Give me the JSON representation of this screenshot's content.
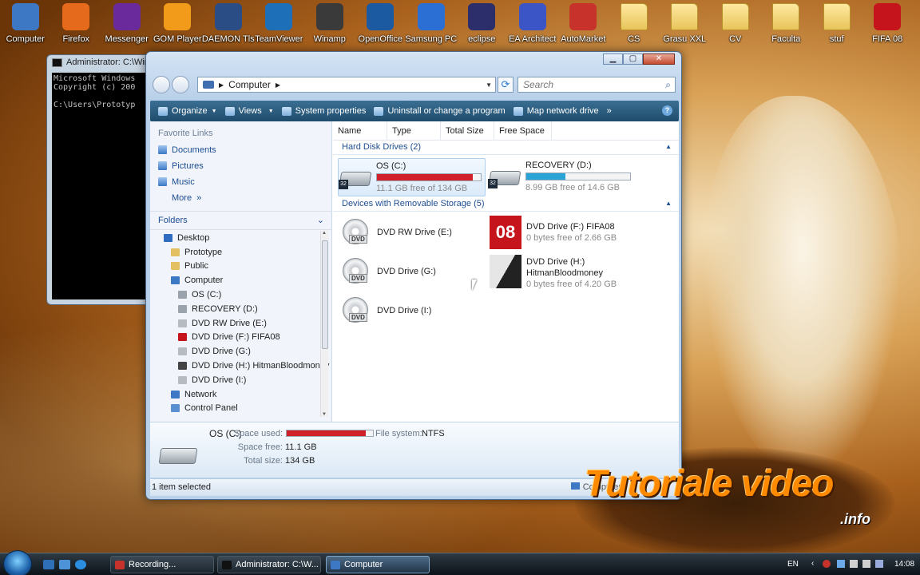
{
  "desktop": {
    "icons": [
      {
        "label": "Computer",
        "color": "#3d78c5"
      },
      {
        "label": "Firefox",
        "color": "#e56a1c"
      },
      {
        "label": "Messenger",
        "color": "#6b2a9c"
      },
      {
        "label": "GOM Player",
        "color": "#f29a1a"
      },
      {
        "label": "DAEMON Tls",
        "color": "#2b4d86"
      },
      {
        "label": "TeamViewer",
        "color": "#1d6fb8"
      },
      {
        "label": "Winamp",
        "color": "#3a3a3a"
      },
      {
        "label": "OpenOffice",
        "color": "#1b5aa0"
      },
      {
        "label": "Samsung PC",
        "color": "#2b6fd4"
      },
      {
        "label": "eclipse",
        "color": "#2c2d6b"
      },
      {
        "label": "EA Architect",
        "color": "#3b55c7"
      },
      {
        "label": "AutoMarket",
        "color": "#c7332b"
      },
      {
        "label": "CS",
        "color": "folder"
      },
      {
        "label": "Grasu XXL",
        "color": "folder"
      },
      {
        "label": "CV",
        "color": "folder"
      },
      {
        "label": "Faculta",
        "color": "folder"
      },
      {
        "label": "stuf",
        "color": "folder"
      },
      {
        "label": "FIFA 08",
        "color": "#c5141b"
      }
    ]
  },
  "cmd": {
    "title": "Administrator: C:\\Win",
    "lines": "Microsoft Windows\nCopyright (c) 200\n\nC:\\Users\\Prototyp"
  },
  "explorer": {
    "address": "Computer",
    "search_placeholder": "Search",
    "toolbar": {
      "organize": "Organize",
      "views": "Views",
      "system_properties": "System properties",
      "uninstall": "Uninstall or change a program",
      "map_drive": "Map network drive",
      "more": "»",
      "help": "?"
    },
    "nav": {
      "favorite_links_header": "Favorite Links",
      "favorites": [
        "Documents",
        "Pictures",
        "Music",
        "More"
      ],
      "more_chevron": "»",
      "folders_header": "Folders",
      "tree": [
        {
          "label": "Desktop",
          "indent": 0,
          "color": "#2f6cc0"
        },
        {
          "label": "Prototype",
          "indent": 1,
          "color": "#e3c062"
        },
        {
          "label": "Public",
          "indent": 1,
          "color": "#e3c062"
        },
        {
          "label": "Computer",
          "indent": 1,
          "color": "#3d78c5"
        },
        {
          "label": "OS (C:)",
          "indent": 2,
          "color": "#9aa3ab"
        },
        {
          "label": "RECOVERY (D:)",
          "indent": 2,
          "color": "#9aa3ab"
        },
        {
          "label": "DVD RW Drive (E:)",
          "indent": 2,
          "color": "#b5bbc0"
        },
        {
          "label": "DVD Drive (F:) FIFA08",
          "indent": 2,
          "color": "#c5141b"
        },
        {
          "label": "DVD Drive (G:)",
          "indent": 2,
          "color": "#b5bbc0"
        },
        {
          "label": "DVD Drive (H:) HitmanBloodmoney",
          "indent": 2,
          "color": "#444"
        },
        {
          "label": "DVD Drive (I:)",
          "indent": 2,
          "color": "#b5bbc0"
        },
        {
          "label": "Network",
          "indent": 1,
          "color": "#3d78c5"
        },
        {
          "label": "Control Panel",
          "indent": 1,
          "color": "#5a8fd0"
        }
      ]
    },
    "columns": [
      "Name",
      "Type",
      "Total Size",
      "Free Space"
    ],
    "groups": {
      "hard_disks": "Hard Disk Drives (2)",
      "removable": "Devices with Removable Storage (5)"
    },
    "drives": {
      "c": {
        "name": "OS (C:)",
        "free": "11.1 GB free of 134 GB",
        "used_fraction": 0.92,
        "bar_color": "#d2202a"
      },
      "d": {
        "name": "RECOVERY (D:)",
        "free": "8.99 GB free of 14.6 GB",
        "used_fraction": 0.38,
        "bar_color": "#2aa3d6"
      },
      "e": {
        "name": "DVD RW Drive (E:)"
      },
      "f": {
        "name": "DVD Drive (F:) FIFA08",
        "free": "0 bytes free of 2.66 GB",
        "art": "08"
      },
      "g": {
        "name": "DVD Drive (G:)"
      },
      "h": {
        "name_line1": "DVD Drive (H:)",
        "name_line2": "HitmanBloodmoney",
        "free": "0 bytes free of 4.20 GB"
      },
      "i": {
        "name": "DVD Drive (I:)"
      },
      "dvd_badge": "DVD",
      "hd_badge": "32"
    },
    "details": {
      "name": "OS (C:)",
      "space_used_label": "Space used:",
      "space_used_fraction": 0.92,
      "file_system_label": "File system:",
      "file_system": "NTFS",
      "space_free_label": "Space free:",
      "space_free": "11.1 GB",
      "total_size_label": "Total size:",
      "total_size": "134 GB"
    },
    "status": {
      "selected": "1 item selected",
      "location": "Computer"
    }
  },
  "taskbar": {
    "tasks": [
      {
        "label": "Recording...",
        "color": "#c7332b",
        "active": false
      },
      {
        "label": "Administrator: C:\\W...",
        "color": "#111",
        "active": false
      },
      {
        "label": "Computer",
        "color": "#3d78c5",
        "active": true
      }
    ],
    "lang": "EN",
    "clock": "14:08"
  },
  "watermark": {
    "main": "Tutoriale video",
    "sub": ".info"
  }
}
